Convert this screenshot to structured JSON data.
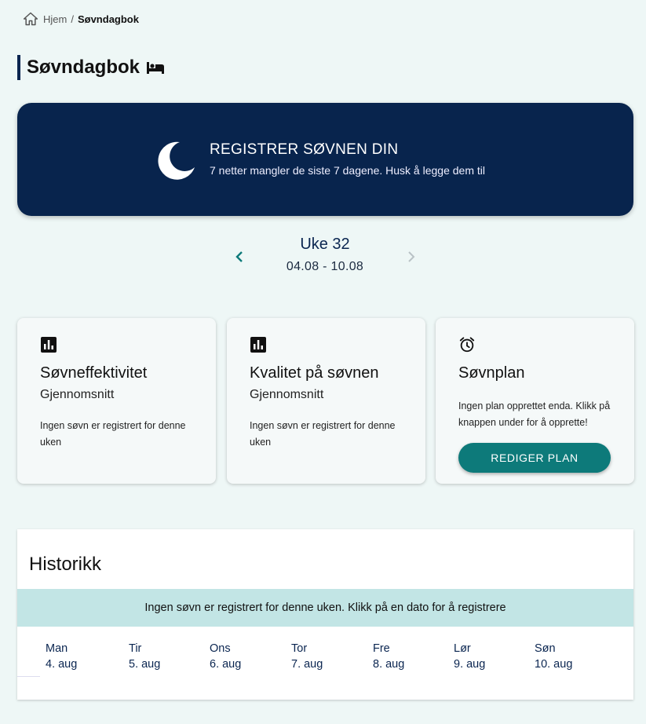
{
  "breadcrumb": {
    "home": "Hjem",
    "separator": "/",
    "current": "Søvndagbok"
  },
  "page": {
    "title": "Søvndagbok"
  },
  "banner": {
    "title": "REGISTRER SØVNEN DIN",
    "subtitle": "7 netter mangler de siste 7 dagene. Husk å legge dem til"
  },
  "week": {
    "label": "Uke 32",
    "range": "04.08 - 10.08"
  },
  "cards": [
    {
      "icon": "bar-chart-icon",
      "title": "Søvneffektivitet",
      "subtitle": "Gjennomsnitt",
      "body": "Ingen søvn er registrert for denne uken"
    },
    {
      "icon": "bar-chart-icon",
      "title": "Kvalitet på søvnen",
      "subtitle": "Gjennomsnitt",
      "body": "Ingen søvn er registrert for denne uken"
    },
    {
      "icon": "alarm-clock-icon",
      "title": "Søvnplan",
      "body": "Ingen plan opprettet enda. Klikk på knappen under for å opprette!",
      "button": "REDIGER PLAN"
    }
  ],
  "history": {
    "title": "Historikk",
    "notice": "Ingen søvn er registrert for denne uken. Klikk på en dato for å registrere",
    "days": [
      {
        "name": "Man",
        "date": "4. aug"
      },
      {
        "name": "Tir",
        "date": "5. aug"
      },
      {
        "name": "Ons",
        "date": "6. aug"
      },
      {
        "name": "Tor",
        "date": "7. aug"
      },
      {
        "name": "Fre",
        "date": "8. aug"
      },
      {
        "name": "Lør",
        "date": "9. aug"
      },
      {
        "name": "Søn",
        "date": "10. aug"
      }
    ]
  },
  "colors": {
    "navy": "#08244d",
    "teal": "#0d7a7a",
    "background": "#eef7f6",
    "notice": "#c2e5e5"
  }
}
